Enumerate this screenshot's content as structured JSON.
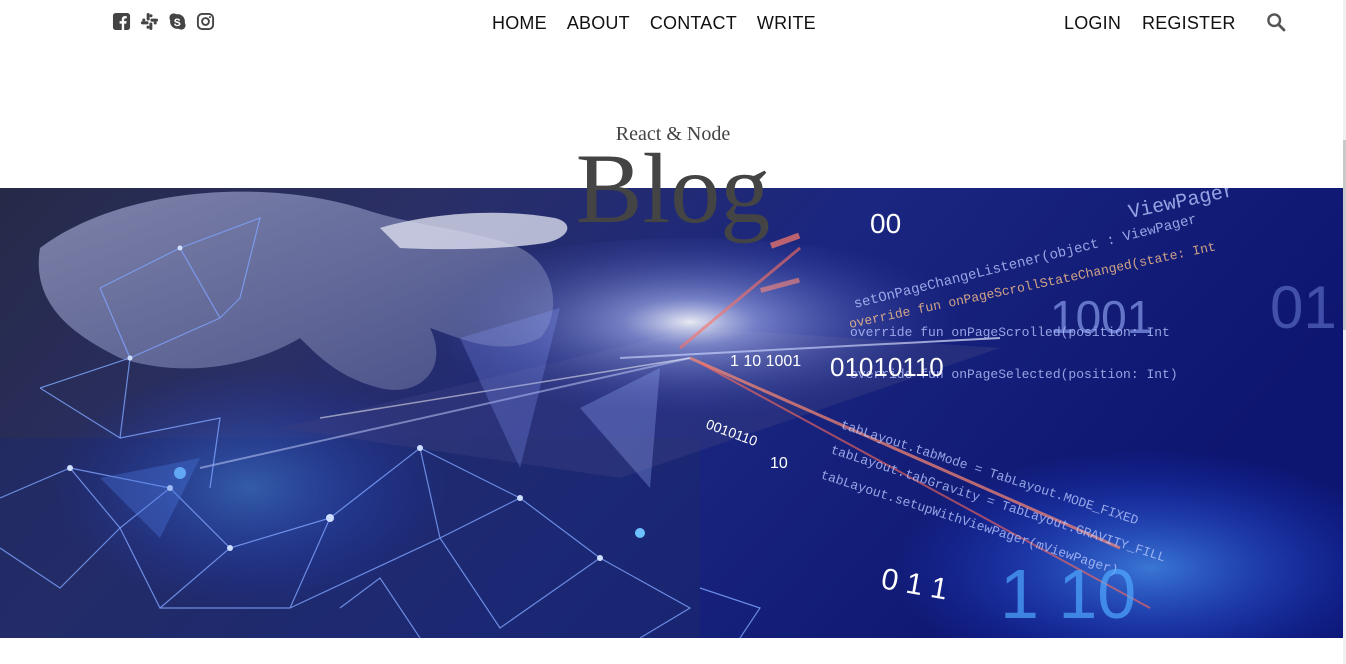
{
  "topbar": {
    "social_icons": [
      "facebook-square-icon",
      "slack-icon",
      "skype-icon",
      "instagram-icon"
    ],
    "nav_center": [
      "HOME",
      "ABOUT",
      "CONTACT",
      "WRITE"
    ],
    "nav_right": [
      "LOGIN",
      "REGISTER"
    ],
    "search_icon": "search-icon"
  },
  "header": {
    "title_small": "React & Node",
    "title_large": "Blog"
  },
  "hero": {
    "image": "hero-tech-image",
    "overlay_text": {
      "code1": "ViewPager",
      "code2": "setOnPageChangeListener(object : ViewPager",
      "code3": "override fun onPageScrollStateChanged(state: Int",
      "code4": "override fun onPageScrolled(position: Int",
      "code5": "override fun onPageSelected(position: Int)",
      "code6": "tabLayout.tabMode = TabLayout.MODE_FIXED",
      "code7": "tabLayout.tabGravity = TabLayout.GRAVITY_FILL",
      "code8": "tabLayout.setupWithViewPager(mViewPager)",
      "bin1": "01010110",
      "bin2": "1 10  1001",
      "bin3": "1001",
      "bin4": "0010110",
      "bin5": "00",
      "bin6": "10",
      "bin7": "0 1 1",
      "bin8": "1 10",
      "bin9": "01"
    }
  },
  "colors": {
    "heading": "#444444",
    "nav_text": "#111111",
    "icon": "#444444",
    "hero_deep": "#0b1a5c",
    "hero_glow": "#3a6cff"
  }
}
